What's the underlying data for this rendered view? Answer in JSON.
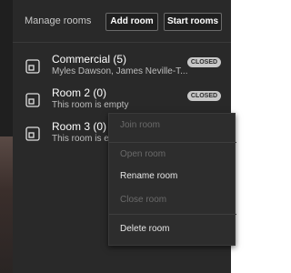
{
  "header": {
    "title": "Manage rooms",
    "add_room_label": "Add room",
    "start_rooms_label": "Start rooms"
  },
  "rooms": [
    {
      "name": "Commercial (5)",
      "subtitle": "Myles Dawson, James Neville-T...",
      "status": "CLOSED"
    },
    {
      "name": "Room 2 (0)",
      "subtitle": "This room is empty",
      "status": "CLOSED"
    },
    {
      "name": "Room 3 (0)",
      "subtitle": "This room is empty",
      "status": ""
    }
  ],
  "context_menu": {
    "items": [
      {
        "label": "Join room",
        "enabled": false
      },
      {
        "label": "Open room",
        "enabled": false
      },
      {
        "label": "Rename room",
        "enabled": true
      },
      {
        "label": "Close room",
        "enabled": false
      },
      {
        "label": "Delete room",
        "enabled": true
      }
    ]
  },
  "colors": {
    "panel_bg": "#292929",
    "menu_bg": "#2d2d2d",
    "badge_bg": "#c8c8c8"
  },
  "icons": {
    "room": "room-icon"
  }
}
